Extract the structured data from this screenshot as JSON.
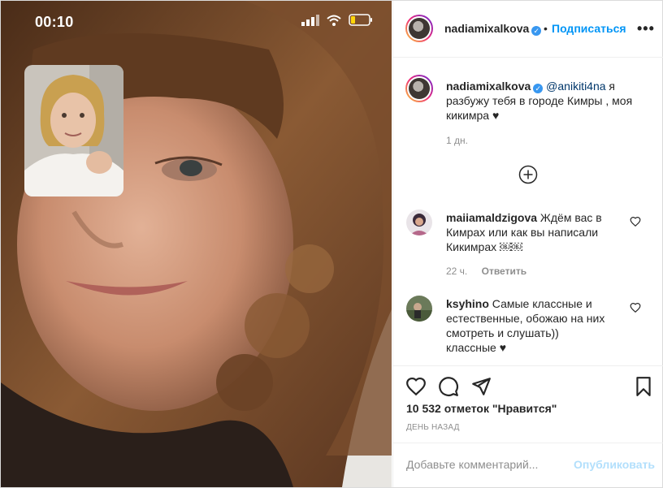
{
  "media": {
    "status_time": "00:10",
    "colors": {
      "hair": "#6b4226",
      "skin": "#c89275",
      "background": "#e6e3df"
    }
  },
  "header": {
    "username": "nadiamixalkova",
    "dot": "•",
    "follow_label": "Подписаться",
    "more_icon": "more-horizontal-icon"
  },
  "caption": {
    "username": "nadiamixalkova",
    "mention": "@anikiti4na",
    "text": " я разбужу тебя в городе Кимры , моя кикимра ♥",
    "time": "1 дн."
  },
  "comments": [
    {
      "username": "maiiamaldzigova",
      "text": " Ждём вас в Кимрах или как вы написали Кикимрах ￼￼",
      "time": "22 ч.",
      "reply_label": "Ответить"
    },
    {
      "username": "ksyhino",
      "text": " Самые классные и естественные, обожаю на них смотреть и слушать)) классные ♥"
    }
  ],
  "actions": {
    "likes": "10 532 отметок \"Нравится\"",
    "date": "День назад"
  },
  "add_comment": {
    "placeholder": "Добавьте комментарий...",
    "publish_label": "Опубликовать"
  },
  "colors": {
    "accent": "#0095f6",
    "publish_disabled": "#b2dffc",
    "meta": "#8e8e8e",
    "verified": "#3897f0"
  }
}
